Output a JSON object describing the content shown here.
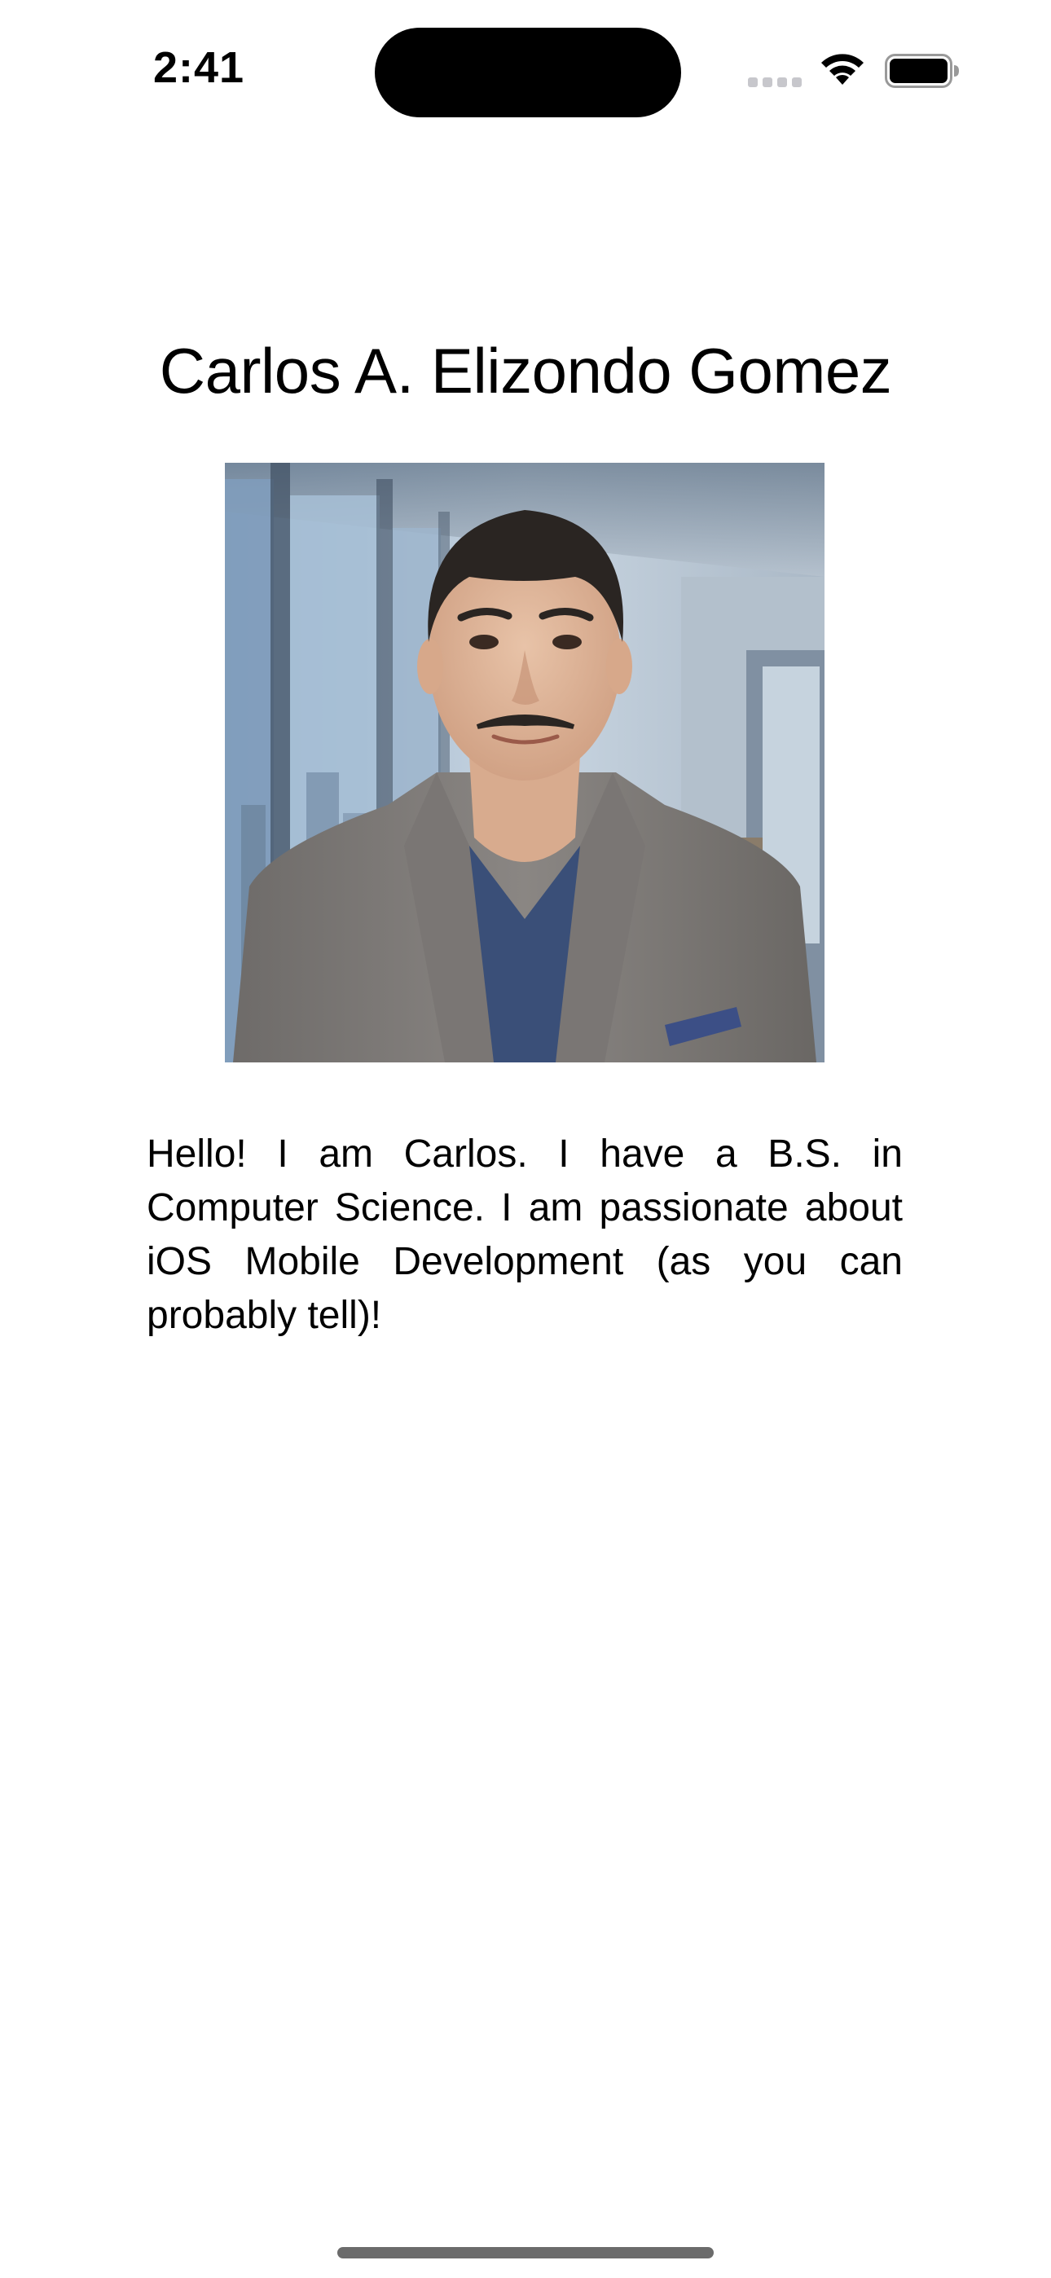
{
  "status_bar": {
    "time": "2:41",
    "icons": [
      "cellular-signal-icon",
      "wifi-icon",
      "battery-icon"
    ]
  },
  "profile": {
    "name": "Carlos A. Elizondo Gomez",
    "photo_icon": "profile-photo",
    "bio": "Hello! I am Carlos. I have a B.S. in Computer Science. I am passionate about iOS Mobile Development (as you can probably tell)!"
  },
  "colors": {
    "background": "#ffffff",
    "text": "#000000",
    "home_indicator": "#6b6b6b"
  }
}
